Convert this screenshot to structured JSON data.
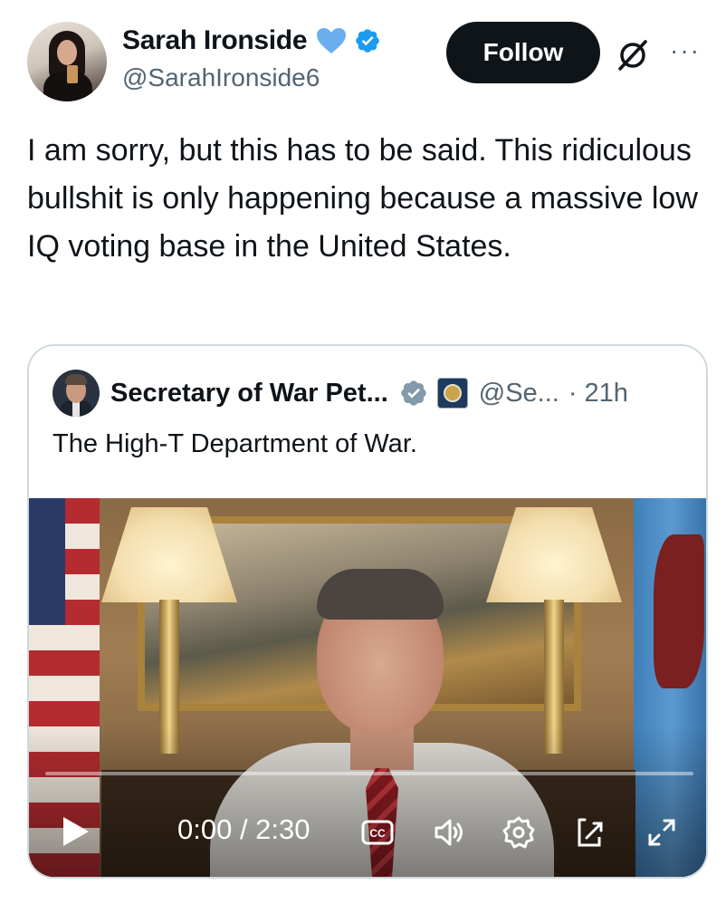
{
  "author": {
    "name": "Sarah Ironside",
    "handle": "@SarahIronside6"
  },
  "actions": {
    "follow_label": "Follow",
    "more_label": "···"
  },
  "tweet": {
    "text": "I am sorry, but this has to be said. This ridiculous bullshit is only happening because a massive low IQ voting base in the United States."
  },
  "quote": {
    "name": "Secretary of War Pet...",
    "handle": "@Se...",
    "separator": "·",
    "time": "21h",
    "text": "The High-T Department of War."
  },
  "video": {
    "time_readout": "0:00 / 2:30",
    "progress": 0,
    "controls": [
      "play-icon",
      "captions-icon",
      "volume-icon",
      "settings-icon",
      "pip-icon",
      "fullscreen-icon"
    ]
  },
  "colors": {
    "verified_blue": "#1d9bf0",
    "heart_blue": "#6aaef0",
    "gray_verified": "#829aab",
    "follow_bg": "#0f1419",
    "text_secondary": "#536471",
    "border": "#cfd9de"
  }
}
